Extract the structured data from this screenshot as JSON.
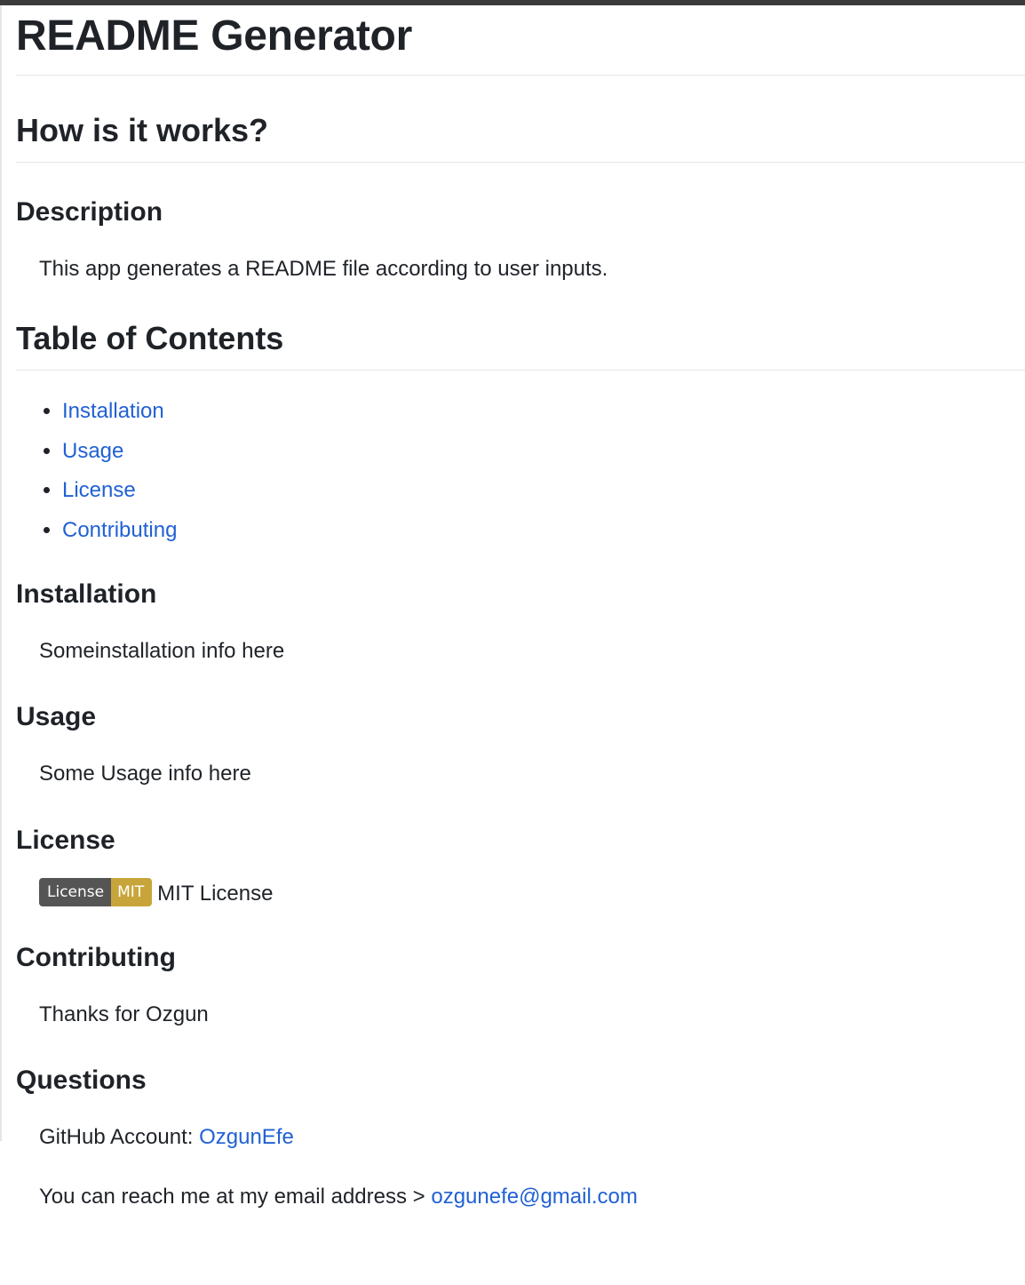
{
  "title": "README Generator",
  "how_heading": "How is it works?",
  "description": {
    "heading": "Description",
    "text": "This app generates a README file according to user inputs."
  },
  "toc": {
    "heading": "Table of Contents",
    "items": [
      "Installation",
      "Usage",
      "License",
      "Contributing"
    ]
  },
  "installation": {
    "heading": "Installation",
    "text": "Someinstallation info here"
  },
  "usage": {
    "heading": "Usage",
    "text": "Some Usage info here"
  },
  "license": {
    "heading": "License",
    "badge_left": "License",
    "badge_right": "MIT",
    "text": "MIT License",
    "badge_colors": {
      "left": "#555555",
      "right": "#c8a53a"
    }
  },
  "contributing": {
    "heading": "Contributing",
    "text": "Thanks for Ozgun"
  },
  "questions": {
    "heading": "Questions",
    "github_label": "GitHub Account: ",
    "github_user": "OzgunEfe",
    "email_label": "You can reach me at my email address > ",
    "email": "ozgunefe@gmail.com"
  },
  "colors": {
    "link": "#2161d4",
    "text": "#1f2328"
  }
}
